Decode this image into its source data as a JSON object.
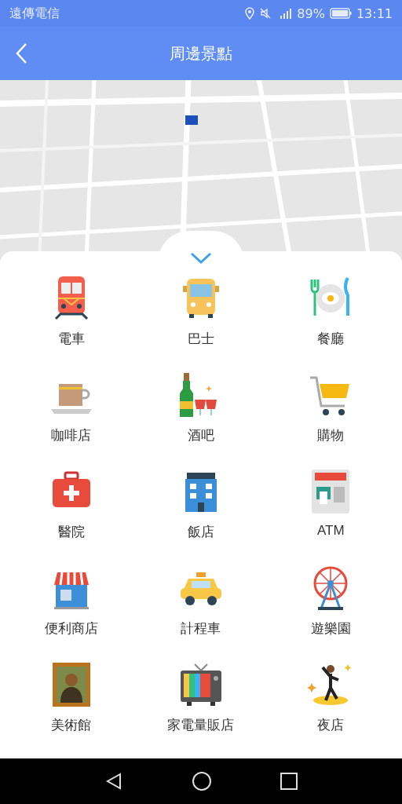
{
  "status_bar": {
    "carrier": "遠傳電信",
    "battery": "89%",
    "time": "13:11"
  },
  "header": {
    "title": "周邊景點"
  },
  "categories": [
    {
      "kind": "train",
      "label": "電車"
    },
    {
      "kind": "bus",
      "label": "巴士"
    },
    {
      "kind": "restaurant",
      "label": "餐廳"
    },
    {
      "kind": "coffee",
      "label": "咖啡店"
    },
    {
      "kind": "bar",
      "label": "酒吧"
    },
    {
      "kind": "shopping",
      "label": "購物"
    },
    {
      "kind": "hospital",
      "label": "醫院"
    },
    {
      "kind": "hotel",
      "label": "飯店"
    },
    {
      "kind": "atm",
      "label": "ATM"
    },
    {
      "kind": "store",
      "label": "便利商店"
    },
    {
      "kind": "taxi",
      "label": "計程車"
    },
    {
      "kind": "amusement",
      "label": "遊樂園"
    },
    {
      "kind": "museum",
      "label": "美術館"
    },
    {
      "kind": "electronics",
      "label": "家電量販店"
    },
    {
      "kind": "nightclub",
      "label": "夜店"
    }
  ]
}
